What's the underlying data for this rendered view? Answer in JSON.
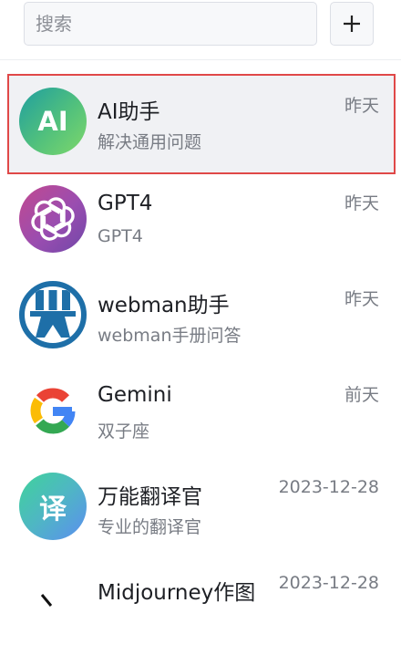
{
  "search": {
    "placeholder": "搜索"
  },
  "toolbar": {
    "add_label": "+"
  },
  "chats": [
    {
      "title": "AI助手",
      "subtitle": "解决通用问题",
      "time": "昨天",
      "avatar_text": "AI",
      "icon": "ai-assistant-icon"
    },
    {
      "title": "GPT4",
      "subtitle": "GPT4",
      "time": "昨天",
      "icon": "openai-logo-icon"
    },
    {
      "title": "webman助手",
      "subtitle": "webman手册问答",
      "time": "昨天",
      "icon": "webman-logo-icon"
    },
    {
      "title": "Gemini",
      "subtitle": "双子座",
      "time": "前天",
      "icon": "google-g-logo-icon"
    },
    {
      "title": "万能翻译官",
      "subtitle": "专业的翻译官",
      "time": "2023-12-28",
      "avatar_text": "译",
      "icon": "translator-icon"
    },
    {
      "title": "Midjourney作图",
      "time": "2023-12-28",
      "icon": "midjourney-logo-icon"
    }
  ],
  "colors": {
    "active_border": "#e04848",
    "active_background": "#f0f1f4",
    "ai_gradient": [
      "#1f9ea0",
      "#7fd86a"
    ],
    "translator_gradient": [
      "#3fd39a",
      "#5b8ef0"
    ],
    "webman_blue": "#1e6fa8"
  }
}
